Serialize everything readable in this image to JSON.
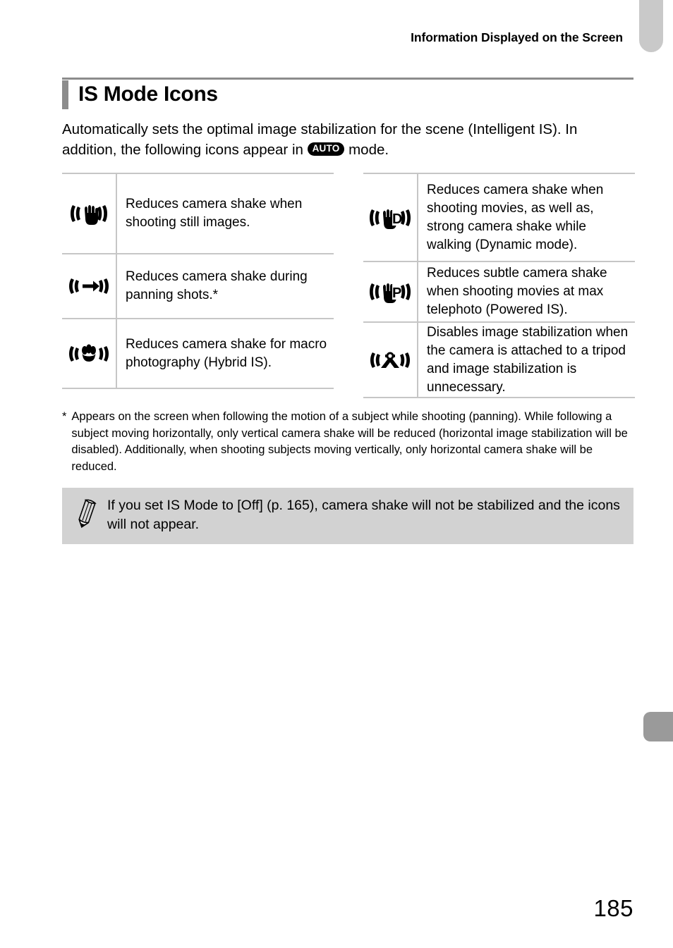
{
  "page": {
    "running_header": "Information Displayed on the Screen",
    "number": "185"
  },
  "section": {
    "title": "IS Mode Icons",
    "intro_part1": "Automatically sets the optimal image stabilization for the scene (Intelligent IS). In addition, the following icons appear in ",
    "intro_badge": "AUTO",
    "intro_part2": " mode."
  },
  "table_left": {
    "rows": [
      {
        "icon": "hand-shake-is-icon",
        "text": "Reduces camera shake when shooting still images."
      },
      {
        "icon": "panning-arrow-is-icon",
        "text": "Reduces camera shake during panning shots.*"
      },
      {
        "icon": "macro-flower-hybrid-is-icon",
        "text": "Reduces camera shake for macro photography (Hybrid IS)."
      }
    ]
  },
  "table_right": {
    "rows": [
      {
        "icon": "hand-dynamic-is-icon",
        "text": "Reduces camera shake when shooting movies, as well as, strong camera shake while walking (Dynamic mode)."
      },
      {
        "icon": "hand-powered-is-icon",
        "text": "Reduces subtle camera shake when shooting movies at max telephoto (Powered IS)."
      },
      {
        "icon": "tripod-is-off-icon",
        "text": "Disables image stabilization when the camera is attached to a tripod and image stabilization is unnecessary."
      }
    ]
  },
  "footnote": {
    "mark": "*",
    "text": "Appears on the screen when following the motion of a subject while shooting (panning). While following a subject moving horizontally, only vertical camera shake will be reduced (horizontal image stabilization will be disabled). Additionally, when shooting subjects moving vertically, only horizontal camera shake will be reduced."
  },
  "note": {
    "icon": "pencil-note-icon",
    "text": "If you set IS Mode to [Off] (p. 165), camera shake will not be stabilized and the icons will not appear."
  },
  "colors": {
    "heading_bar": "#8c8c8c",
    "table_rule": "#c6c6c6",
    "note_background": "#d2d2d2",
    "tab_top": "#c9c9c9",
    "tab_lower": "#9a9a9a"
  }
}
